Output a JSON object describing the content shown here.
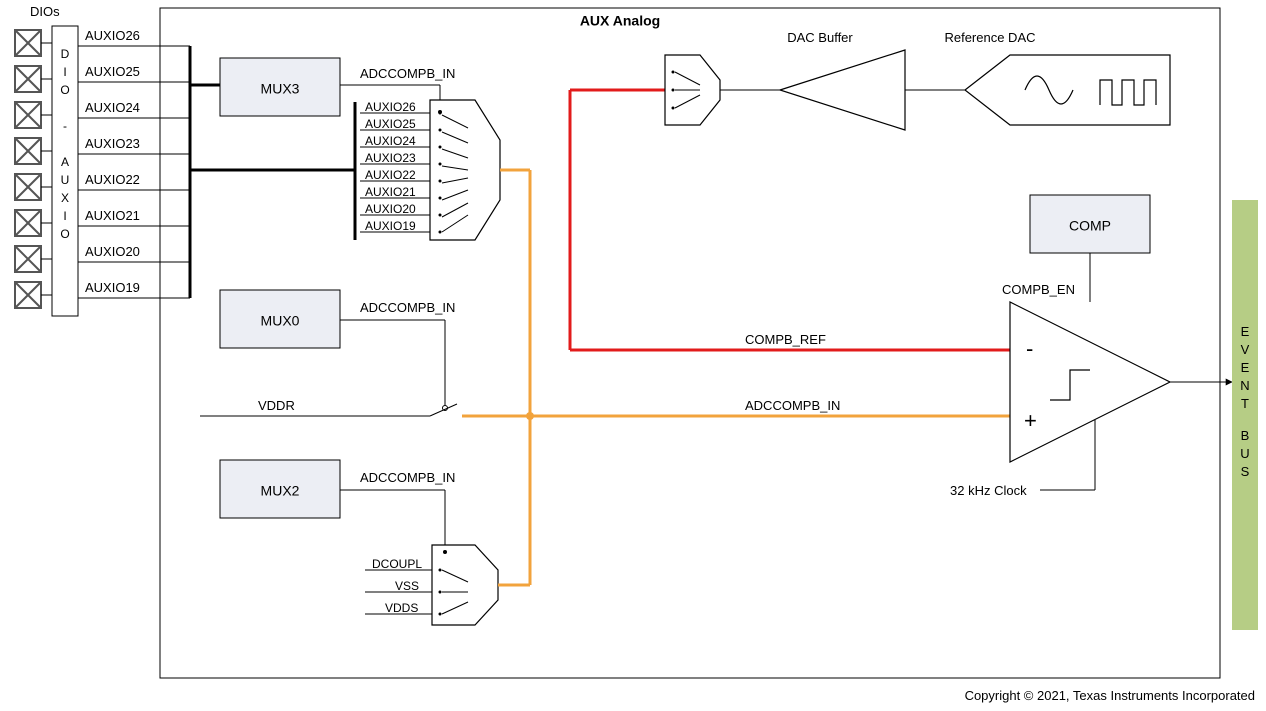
{
  "title": "AUX Analog",
  "dio_header": "DIOs",
  "dio_auxio_vertical": "DIO - AUXIO",
  "auxio_labels": [
    "AUXIO26",
    "AUXIO25",
    "AUXIO24",
    "AUXIO23",
    "AUXIO22",
    "AUXIO21",
    "AUXIO20",
    "AUXIO19"
  ],
  "mux3_label": "MUX3",
  "mux0_label": "MUX0",
  "mux2_label": "MUX2",
  "adccompb_in": "ADCCOMPB_IN",
  "mux_inputs_big": [
    "AUXIO26",
    "AUXIO25",
    "AUXIO24",
    "AUXIO23",
    "AUXIO22",
    "AUXIO21",
    "AUXIO20",
    "AUXIO19"
  ],
  "mux2_inputs": [
    "DCOUPL",
    "VSS",
    "VDDS"
  ],
  "vddr_label": "VDDR",
  "dac_buffer_label": "DAC Buffer",
  "reference_dac_label": "Reference DAC",
  "comp_label": "COMP",
  "compb_en_label": "COMPB_EN",
  "compb_ref_label": "COMPB_REF",
  "adccompb_in_net": "ADCCOMPB_IN",
  "clk_label": "32 kHz Clock",
  "event_bus_label": "EVENT BUS",
  "copyright": "Copyright © 2021, Texas Instruments Incorporated"
}
